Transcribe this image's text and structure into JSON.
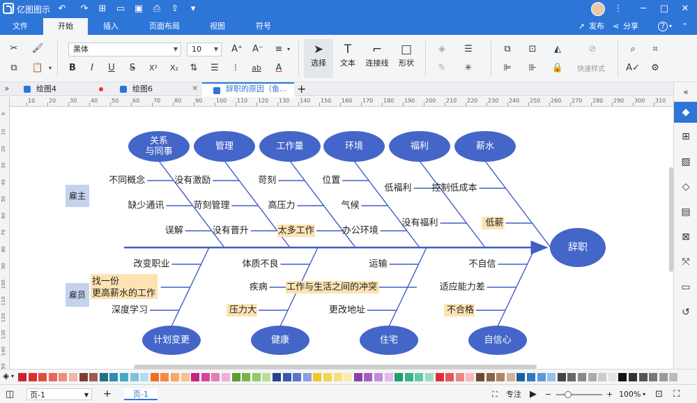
{
  "app": {
    "title": "亿图图示"
  },
  "window": {
    "minimize": "─",
    "maximize": "□",
    "close": "✕"
  },
  "menu": {
    "tabs": [
      "文件",
      "开始",
      "插入",
      "页面布局",
      "视图",
      "符号"
    ],
    "active": "开始",
    "publish": "发布",
    "share": "分享",
    "help": "?"
  },
  "ribbon": {
    "font_name": "黑体",
    "font_size": "10",
    "tools": {
      "select": "选择",
      "text": "文本",
      "connector": "连接线",
      "shape": "形状"
    },
    "quick_style": "快速样式"
  },
  "doc_tabs": [
    {
      "label": "绘图4",
      "state": "unsaved"
    },
    {
      "label": "绘图6",
      "state": "normal"
    },
    {
      "label": "辞职的原因（鱼...",
      "state": "active"
    }
  ],
  "rulers": {
    "h_ticks": [
      "10",
      "20",
      "30",
      "40",
      "50",
      "60",
      "70",
      "80",
      "90",
      "100",
      "110",
      "120",
      "130",
      "140",
      "150",
      "160",
      "170",
      "180",
      "190",
      "200",
      "210",
      "220",
      "230",
      "240",
      "250",
      "260",
      "270",
      "280",
      "290",
      "300",
      "310"
    ],
    "v_ticks": [
      "0",
      "10",
      "20",
      "30",
      "40",
      "50",
      "60",
      "70",
      "80",
      "90",
      "100",
      "110",
      "120",
      "130",
      "140",
      "150"
    ]
  },
  "diagram": {
    "head": "辞职",
    "top_categories": [
      "关系\n与同事",
      "管理",
      "工作量",
      "环境",
      "福利",
      "薪水"
    ],
    "bottom_categories": [
      "计划变更",
      "健康",
      "住宅",
      "自信心"
    ],
    "side_labels": {
      "employer": "雇主",
      "employee": "雇员"
    },
    "causes": {
      "relations": [
        "不同概念",
        "缺少通讯",
        "误解"
      ],
      "management": [
        "没有激励",
        "苛刻管理",
        "没有晋升"
      ],
      "workload": [
        "苛刻",
        "高压力",
        "太多工作"
      ],
      "environment": [
        "位置",
        "气候",
        "办公环境"
      ],
      "welfare": [
        "低福利",
        "没有福利"
      ],
      "salary": [
        "控制低成本",
        "低薪"
      ],
      "plan_change": [
        "改变职业",
        "找一份\n更高薪水的工作",
        "深度学习"
      ],
      "health": [
        "体质不良",
        "疾病",
        "压力大"
      ],
      "health_extra": "工作与生活之间的冲突",
      "housing": [
        "运输",
        "更改地址"
      ],
      "confidence": [
        "不自信",
        "适应能力差",
        "不合格"
      ]
    }
  },
  "colors": {
    "accent": "#2e75d8",
    "node_fill": "#4466c8",
    "side_box": "#c4d2ee",
    "highlight": "#fde3b2",
    "line": "#3e5fc4",
    "palette": [
      "#c8262d",
      "#d7332a",
      "#e04d3f",
      "#e8675a",
      "#ef8c80",
      "#f5b3aa",
      "#7c3f35",
      "#a05a4e",
      "#1f6f8b",
      "#2b8fb0",
      "#45a9c9",
      "#7cc4dc",
      "#b4dcec",
      "#f26d21",
      "#f48a3f",
      "#f7a862",
      "#f9c18d",
      "#c3247b",
      "#d8469a",
      "#e57bb8",
      "#efaed3",
      "#5a9e2f",
      "#76b545",
      "#97c86b",
      "#bddb9d",
      "#2b3f8c",
      "#3b56ad",
      "#5b74c8",
      "#8d9fdc",
      "#f2c52b",
      "#f5d352",
      "#f8e07d",
      "#fbeab0",
      "#8c3fa8",
      "#a95dc2",
      "#c58ad8",
      "#e0b9ea",
      "#1f9e6e",
      "#33b684",
      "#64c9a1",
      "#9edcc2",
      "#dd2f2f",
      "#e65656",
      "#ef8585",
      "#f7b9b9",
      "#6b4b2e",
      "#8b6442",
      "#ad8763",
      "#d0b394",
      "#1d5f9e",
      "#2e7bc2",
      "#5a9ad6",
      "#96c0e8",
      "#444444",
      "#666666",
      "#888888",
      "#aaaaaa",
      "#cccccc",
      "#e4e4e4",
      "#111111",
      "#333333",
      "#555555",
      "#777777",
      "#999999",
      "#bbbbbb"
    ]
  },
  "status": {
    "page_select": "页-1",
    "add_page": "+",
    "page_tab": "页-1",
    "focus": "专注",
    "zoom": "100%"
  }
}
